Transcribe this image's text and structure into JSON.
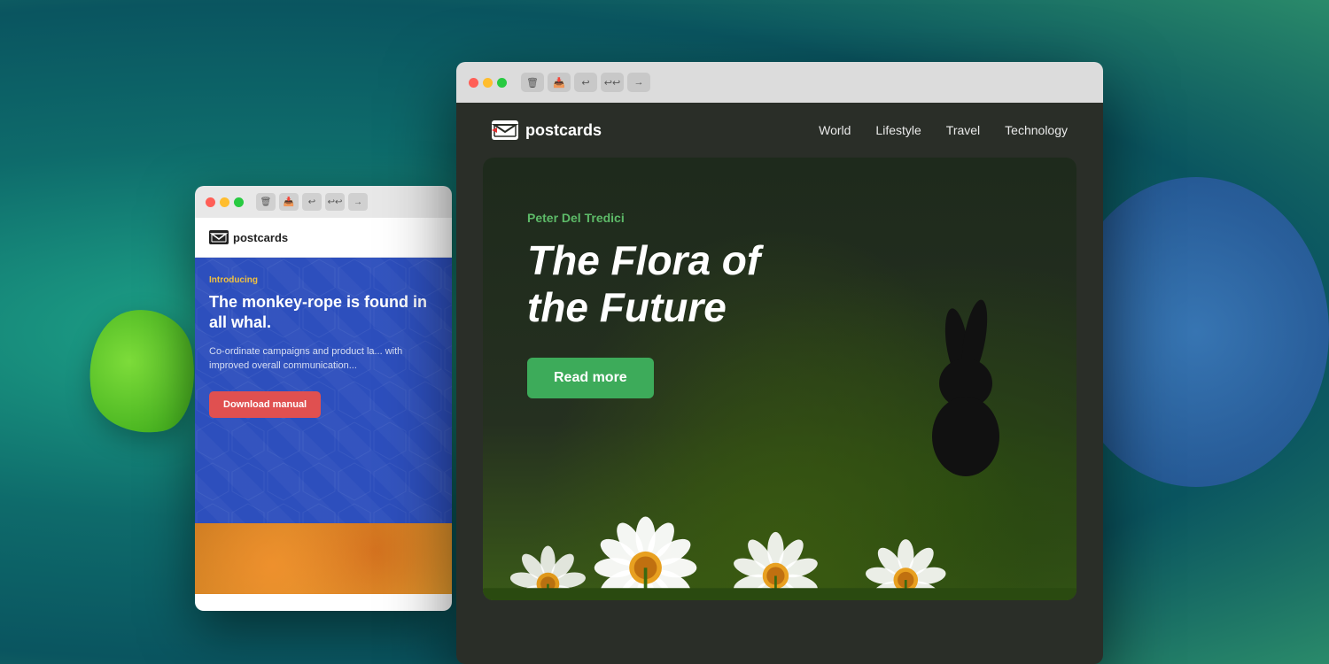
{
  "background": {
    "gradient": "teal-green radial"
  },
  "window_back": {
    "titlebar": {
      "traffic_lights": [
        "red",
        "yellow",
        "green"
      ],
      "buttons": [
        "trash",
        "archive",
        "reply",
        "reply-all",
        "forward"
      ]
    },
    "email": {
      "logo": "postcards",
      "introducing_label": "Introducing",
      "headline": "The monkey-rope is found in all whal.",
      "description": "Co-ordinate campaigns and product la... with improved overall communication...",
      "download_btn_label": "Download manual"
    }
  },
  "window_front": {
    "titlebar": {
      "traffic_lights": [
        "red",
        "yellow",
        "green"
      ],
      "buttons": [
        "trash",
        "archive",
        "reply",
        "reply-all",
        "forward"
      ]
    },
    "email": {
      "logo": "postcards",
      "nav_links": [
        "World",
        "Lifestyle",
        "Travel",
        "Technology"
      ],
      "hero": {
        "author": "Peter Del Tredici",
        "title_line1": "The Flora of",
        "title_line2": "the Future",
        "read_more_label": "Read more"
      }
    }
  }
}
